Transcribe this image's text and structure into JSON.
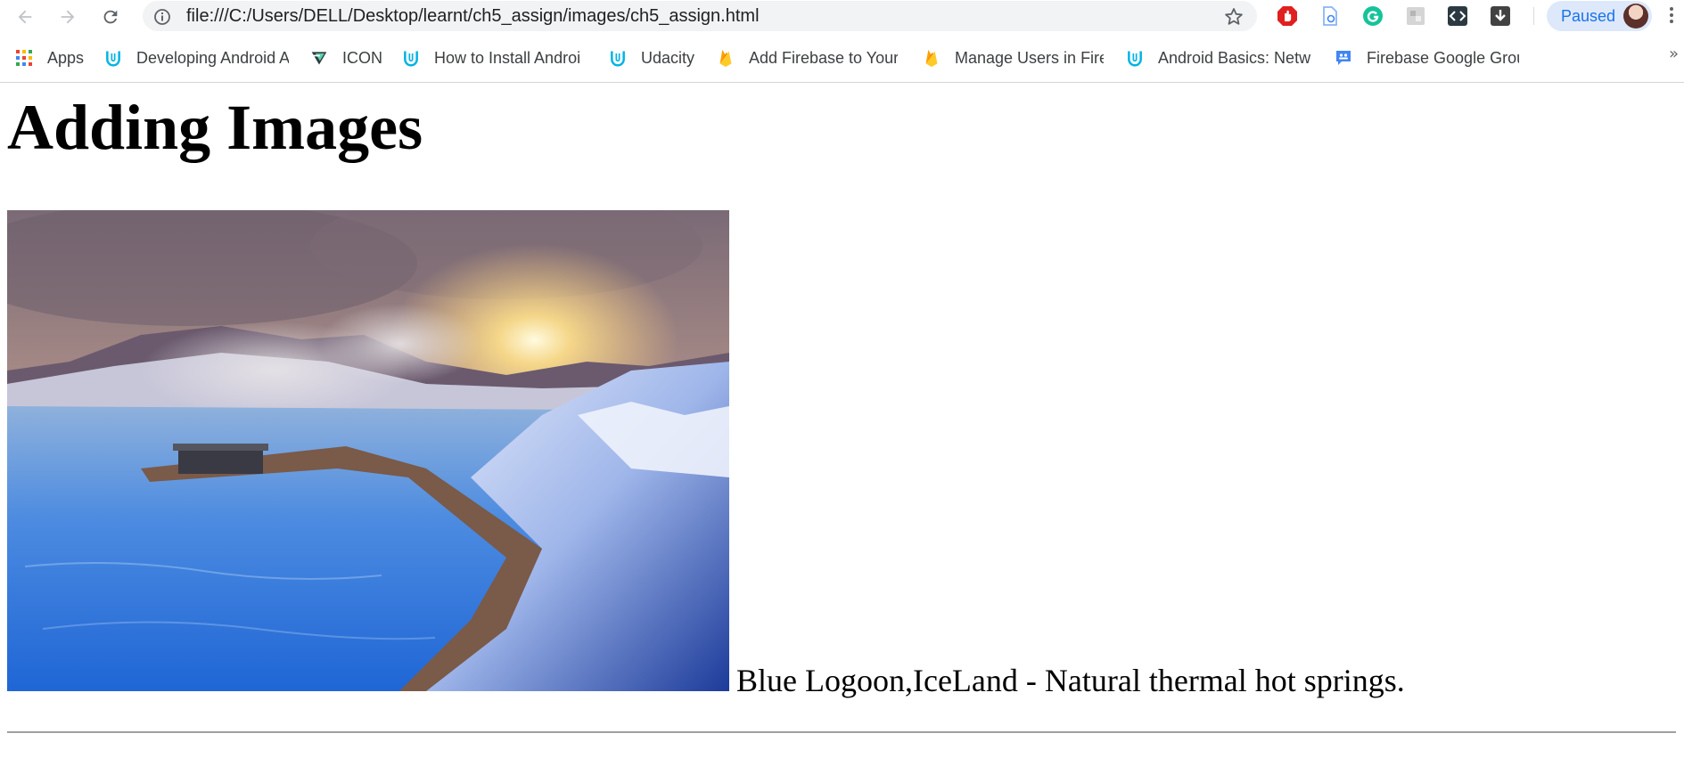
{
  "browser": {
    "url": "file:///C:/Users/DELL/Desktop/learnt/ch5_assign/images/ch5_assign.html",
    "profile_status": "Paused",
    "extensions": [
      "adblock-icon",
      "document-icon",
      "grammarly-icon",
      "extension-gray-icon",
      "code-icon",
      "download-icon"
    ]
  },
  "bookmarks": {
    "items": [
      {
        "label": "Apps",
        "icon": "apps-grid-icon"
      },
      {
        "label": "Developing Android A",
        "icon": "udacity-icon"
      },
      {
        "label": "ICON",
        "icon": "icon-v-logo"
      },
      {
        "label": "How to Install Androi",
        "icon": "udacity-icon"
      },
      {
        "label": "Udacity",
        "icon": "udacity-icon"
      },
      {
        "label": "Add Firebase to Your",
        "icon": "firebase-icon"
      },
      {
        "label": "Manage Users in Fireb",
        "icon": "firebase-icon"
      },
      {
        "label": "Android Basics: Netw",
        "icon": "udacity-icon"
      },
      {
        "label": "Firebase Google Grou",
        "icon": "google-groups-icon"
      }
    ],
    "overflow": "»"
  },
  "page": {
    "title": "Adding Images",
    "caption": "Blue Logoon,IceLand - Natural thermal hot springs."
  },
  "colors": {
    "accent_blue": "#1a73e8",
    "udacity": "#02b3e4",
    "firebase": "#ffca28"
  }
}
